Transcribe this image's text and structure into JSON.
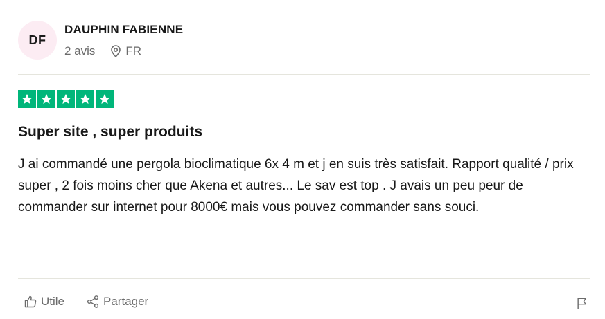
{
  "reviewer": {
    "initials": "DF",
    "name": "DAUPHIN FABIENNE",
    "review_count": "2 avis",
    "country": "FR",
    "location_icon": "map-pin-icon"
  },
  "rating": {
    "stars": 5,
    "max": 5,
    "color": "#00b67a",
    "icon": "star-icon"
  },
  "review": {
    "title": "Super site , super produits",
    "body": "J ai commandé une pergola bioclimatique 6x 4 m et j en suis très satisfait. Rapport qualité / prix super , 2 fois moins cher que Akena et autres... Le sav est top . J avais un peu peur de commander sur internet pour 8000€ mais vous pouvez commander sans souci."
  },
  "actions": {
    "useful_label": "Utile",
    "useful_icon": "thumbs-up-icon",
    "share_label": "Partager",
    "share_icon": "share-icon",
    "report_icon": "flag-icon"
  }
}
